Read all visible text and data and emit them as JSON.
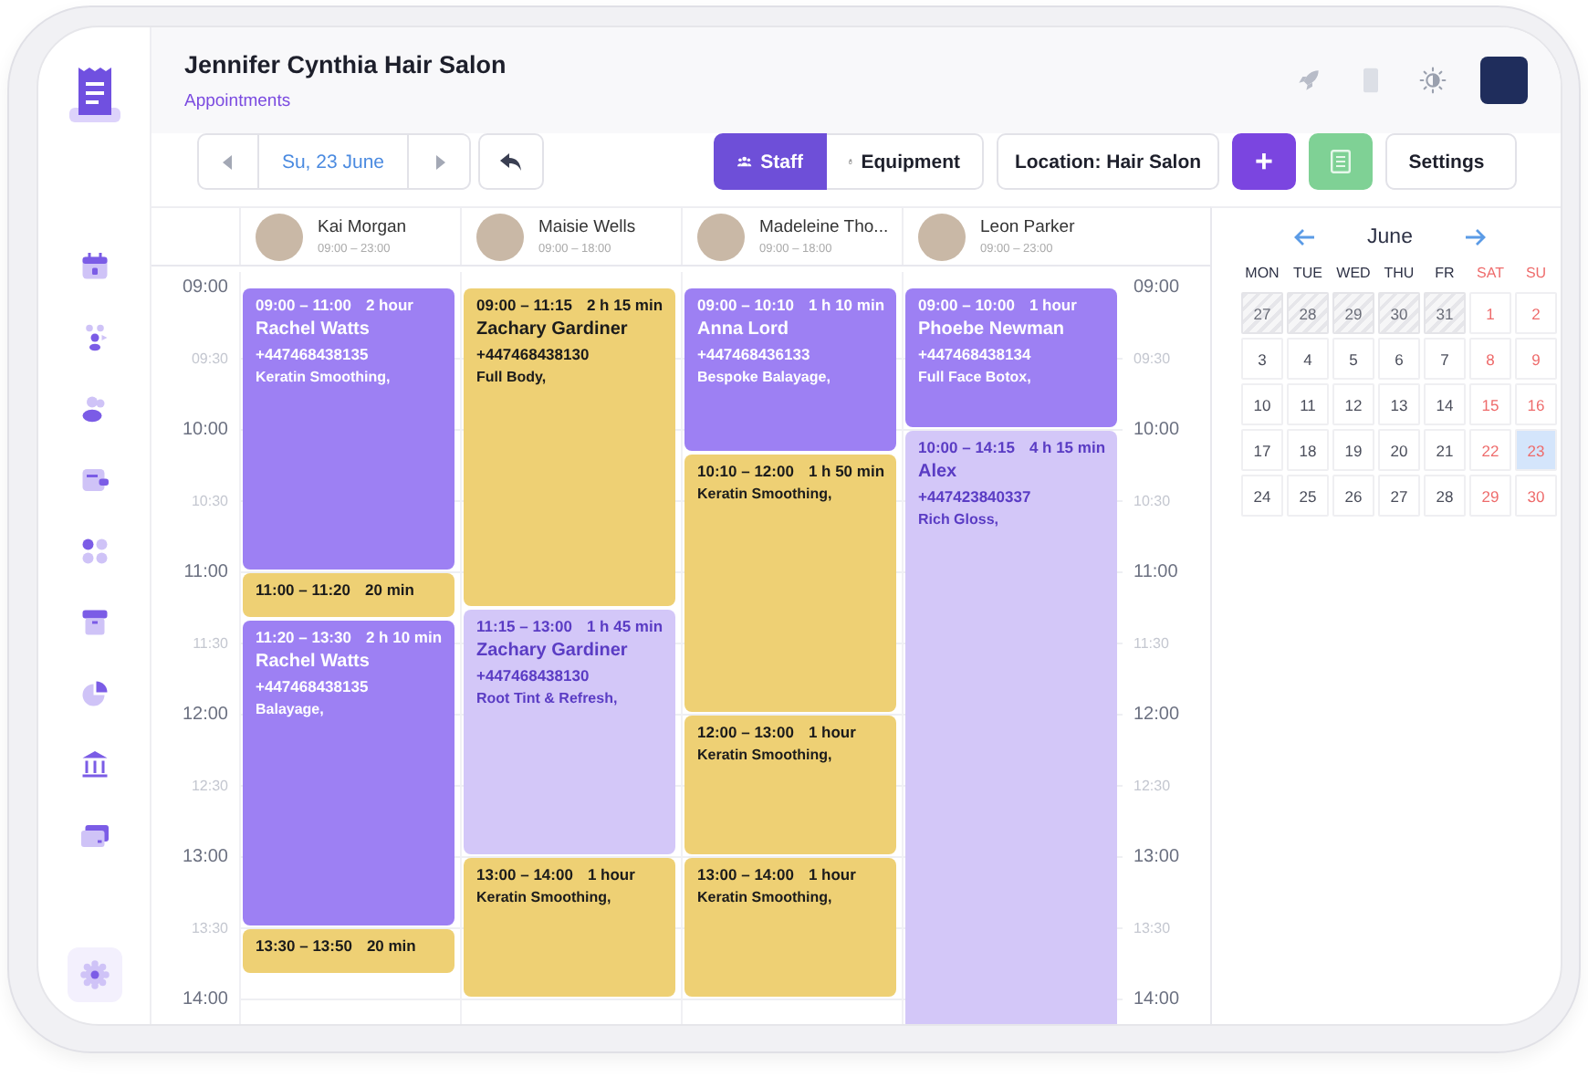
{
  "sidebar": {
    "items": [
      {
        "kind": "calendar",
        "selected": false
      },
      {
        "kind": "team",
        "selected": false
      },
      {
        "kind": "clients",
        "selected": false
      },
      {
        "kind": "wallet",
        "selected": false
      },
      {
        "kind": "apps",
        "selected": false
      },
      {
        "kind": "archive",
        "selected": false
      },
      {
        "kind": "reports",
        "selected": false
      },
      {
        "kind": "bank",
        "selected": false
      },
      {
        "kind": "card",
        "selected": false
      },
      {
        "kind": "settings",
        "selected": true
      }
    ]
  },
  "header": {
    "title": "Jennifer Cynthia Hair Salon",
    "subtitle": "Appointments"
  },
  "toolbar": {
    "date": "Su, 23 June",
    "views": [
      {
        "label": "Staff",
        "selected": true
      },
      {
        "label": "Equipment",
        "selected": false
      }
    ],
    "location": "Location: Hair Salon",
    "add": "+",
    "settings": "Settings"
  },
  "time_axis": [
    {
      "label": "09:00",
      "kind": "hour"
    },
    {
      "label": "09:30",
      "kind": "half"
    },
    {
      "label": "10:00",
      "kind": "hour"
    },
    {
      "label": "10:30",
      "kind": "half"
    },
    {
      "label": "11:00",
      "kind": "hour"
    },
    {
      "label": "11:30",
      "kind": "half"
    },
    {
      "label": "12:00",
      "kind": "hour"
    },
    {
      "label": "12:30",
      "kind": "half"
    },
    {
      "label": "13:00",
      "kind": "hour"
    },
    {
      "label": "13:30",
      "kind": "half"
    },
    {
      "label": "14:00",
      "kind": "hour"
    }
  ],
  "time_axis_right": [
    {
      "label": "09:00",
      "kind": "hour"
    },
    {
      "label": "09:30",
      "kind": "half"
    },
    {
      "label": "10:00",
      "kind": "hour"
    },
    {
      "label": "10:30",
      "kind": "half"
    },
    {
      "label": "11:00",
      "kind": "hour"
    },
    {
      "label": "11:30",
      "kind": "half"
    },
    {
      "label": "12:00",
      "kind": "hour"
    },
    {
      "label": "12:30",
      "kind": "half"
    },
    {
      "label": "13:00",
      "kind": "hour"
    },
    {
      "label": "13:30",
      "kind": "half"
    },
    {
      "label": "14:00",
      "kind": "hour"
    }
  ],
  "staff": [
    {
      "name": "Kai Morgan",
      "hours": "09:00 – 23:00",
      "events": [
        {
          "time": "09:00 – 11:00",
          "duration": "2 hour",
          "client": "Rachel Watts",
          "phone": "+447468438135",
          "service": "Keratin Smoothing,",
          "color": "#9d80f3"
        },
        {
          "time": "11:00 – 11:20",
          "duration": "20 min",
          "color": "#eed074"
        },
        {
          "time": "11:20 – 13:30",
          "duration": "2 h 10 min",
          "client": "Rachel Watts",
          "phone": "+447468438135",
          "service": "Balayage,",
          "color": "#9d80f3"
        },
        {
          "time": "13:30 – 13:50",
          "duration": "20 min",
          "color": "#eed074"
        }
      ]
    },
    {
      "name": "Maisie Wells",
      "hours": "09:00 – 18:00",
      "events": [
        {
          "time": "09:00 – 11:15",
          "duration": "2 h 15 min",
          "client": "Zachary Gardiner",
          "phone": "+447468438130",
          "service": "Full Body,",
          "color": "#eed074"
        },
        {
          "time": "11:15 – 13:00",
          "duration": "1 h 45 min",
          "client": "Zachary Gardiner",
          "phone": "+447468438130",
          "service": "Root Tint & Refresh,",
          "color": "#d3c7f8"
        },
        {
          "time": "13:00 – 14:00",
          "duration": "1 hour",
          "service": "Keratin Smoothing,",
          "color": "#eed074"
        }
      ]
    },
    {
      "name": "Madeleine Tho...",
      "hours": "09:00 – 18:00",
      "events": [
        {
          "time": "09:00 – 10:10",
          "duration": "1 h 10 min",
          "client": "Anna Lord",
          "phone": "+447468436133",
          "service": "Bespoke Balayage,",
          "color": "#9d80f3"
        },
        {
          "time": "10:10 – 12:00",
          "duration": "1 h 50 min",
          "service": "Keratin Smoothing,",
          "color": "#eed074"
        },
        {
          "time": "12:00 – 13:00",
          "duration": "1 hour",
          "service": "Keratin Smoothing,",
          "color": "#eed074"
        },
        {
          "time": "13:00 – 14:00",
          "duration": "1 hour",
          "service": "Keratin Smoothing,",
          "color": "#eed074"
        }
      ]
    },
    {
      "name": "Leon Parker",
      "hours": "09:00 – 23:00",
      "events": [
        {
          "time": "09:00 – 10:00",
          "duration": "1 hour",
          "client": "Phoebe Newman",
          "phone": "+447468438134",
          "service": "Full Face Botox,",
          "color": "#9d80f3"
        },
        {
          "time": "10:00 – 14:15",
          "duration": "4 h 15 min",
          "client": "Alex",
          "phone": "+447423840337",
          "service": "Rich Gloss,",
          "color": "#d3c7f8"
        }
      ]
    }
  ],
  "calendar": {
    "month": "June",
    "weekdays": [
      {
        "label": "MON",
        "weekend": false
      },
      {
        "label": "TUE",
        "weekend": false
      },
      {
        "label": "WED",
        "weekend": false
      },
      {
        "label": "THU",
        "weekend": false
      },
      {
        "label": "FR",
        "weekend": false
      },
      {
        "label": "SAT",
        "weekend": true
      },
      {
        "label": "SU",
        "weekend": true
      }
    ],
    "days": [
      {
        "label": "27",
        "outside": true,
        "weekend": false,
        "selected": false
      },
      {
        "label": "28",
        "outside": true,
        "weekend": false,
        "selected": false
      },
      {
        "label": "29",
        "outside": true,
        "weekend": false,
        "selected": false
      },
      {
        "label": "30",
        "outside": true,
        "weekend": false,
        "selected": false
      },
      {
        "label": "31",
        "outside": true,
        "weekend": false,
        "selected": false
      },
      {
        "label": "1",
        "outside": false,
        "weekend": true,
        "selected": false
      },
      {
        "label": "2",
        "outside": false,
        "weekend": true,
        "selected": false
      },
      {
        "label": "3",
        "outside": false,
        "weekend": false,
        "selected": false
      },
      {
        "label": "4",
        "outside": false,
        "weekend": false,
        "selected": false
      },
      {
        "label": "5",
        "outside": false,
        "weekend": false,
        "selected": false
      },
      {
        "label": "6",
        "outside": false,
        "weekend": false,
        "selected": false
      },
      {
        "label": "7",
        "outside": false,
        "weekend": false,
        "selected": false
      },
      {
        "label": "8",
        "outside": false,
        "weekend": true,
        "selected": false
      },
      {
        "label": "9",
        "outside": false,
        "weekend": true,
        "selected": false
      },
      {
        "label": "10",
        "outside": false,
        "weekend": false,
        "selected": false
      },
      {
        "label": "11",
        "outside": false,
        "weekend": false,
        "selected": false
      },
      {
        "label": "12",
        "outside": false,
        "weekend": false,
        "selected": false
      },
      {
        "label": "13",
        "outside": false,
        "weekend": false,
        "selected": false
      },
      {
        "label": "14",
        "outside": false,
        "weekend": false,
        "selected": false
      },
      {
        "label": "15",
        "outside": false,
        "weekend": true,
        "selected": false
      },
      {
        "label": "16",
        "outside": false,
        "weekend": true,
        "selected": false
      },
      {
        "label": "17",
        "outside": false,
        "weekend": false,
        "selected": false
      },
      {
        "label": "18",
        "outside": false,
        "weekend": false,
        "selected": false
      },
      {
        "label": "19",
        "outside": false,
        "weekend": false,
        "selected": false
      },
      {
        "label": "20",
        "outside": false,
        "weekend": false,
        "selected": false
      },
      {
        "label": "21",
        "outside": false,
        "weekend": false,
        "selected": false
      },
      {
        "label": "22",
        "outside": false,
        "weekend": true,
        "selected": false
      },
      {
        "label": "23",
        "outside": false,
        "weekend": true,
        "selected": true
      },
      {
        "label": "24",
        "outside": false,
        "weekend": false,
        "selected": false
      },
      {
        "label": "25",
        "outside": false,
        "weekend": false,
        "selected": false
      },
      {
        "label": "26",
        "outside": false,
        "weekend": false,
        "selected": false
      },
      {
        "label": "27",
        "outside": false,
        "weekend": false,
        "selected": false
      },
      {
        "label": "28",
        "outside": false,
        "weekend": false,
        "selected": false
      },
      {
        "label": "29",
        "outside": false,
        "weekend": true,
        "selected": false
      },
      {
        "label": "30",
        "outside": false,
        "weekend": true,
        "selected": false
      }
    ]
  }
}
